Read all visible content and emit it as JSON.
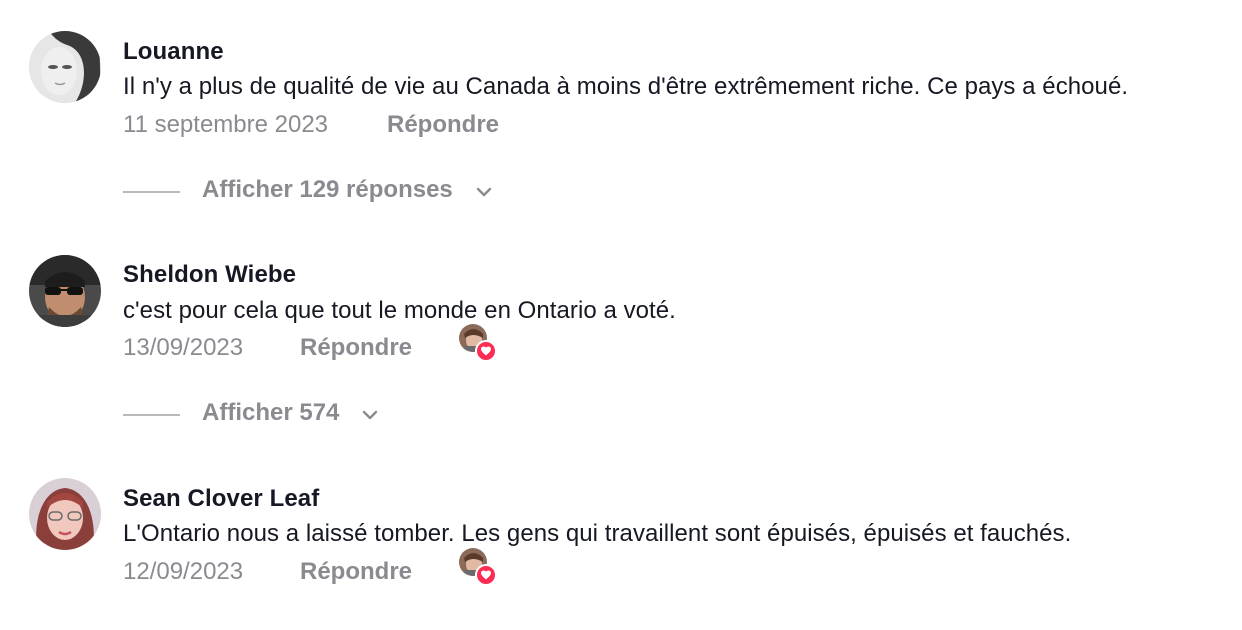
{
  "comments": [
    {
      "author": "Louanne",
      "text": "Il n'y a plus de qualité de vie au Canada à moins d'être extrêmement riche. Ce pays a échoué.",
      "date": "11 septembre 2023",
      "reply_label": "Répondre",
      "avatar_icon": "avatar-louanne",
      "liked_by_creator": false,
      "replies_label": "Afficher 129 réponses"
    },
    {
      "author": "Sheldon Wiebe",
      "text": "c'est pour cela que tout le monde en Ontario a voté.",
      "date": "13/09/2023",
      "reply_label": "Répondre",
      "avatar_icon": "avatar-sheldon",
      "liked_by_creator": true,
      "replies_label": "Afficher 574"
    },
    {
      "author": "Sean Clover Leaf",
      "text": "L'Ontario nous a laissé tomber. Les gens qui travaillent sont épuisés, épuisés et fauchés.",
      "date": "12/09/2023",
      "reply_label": "Répondre",
      "avatar_icon": "avatar-sean",
      "liked_by_creator": true
    }
  ],
  "colors": {
    "text": "#161823",
    "muted": "#8a8b91",
    "like_accent": "#fe2c55",
    "divider": "#b9b9bd"
  },
  "icons": {
    "chevron": "chevron-down-icon",
    "like": "heart-icon"
  }
}
